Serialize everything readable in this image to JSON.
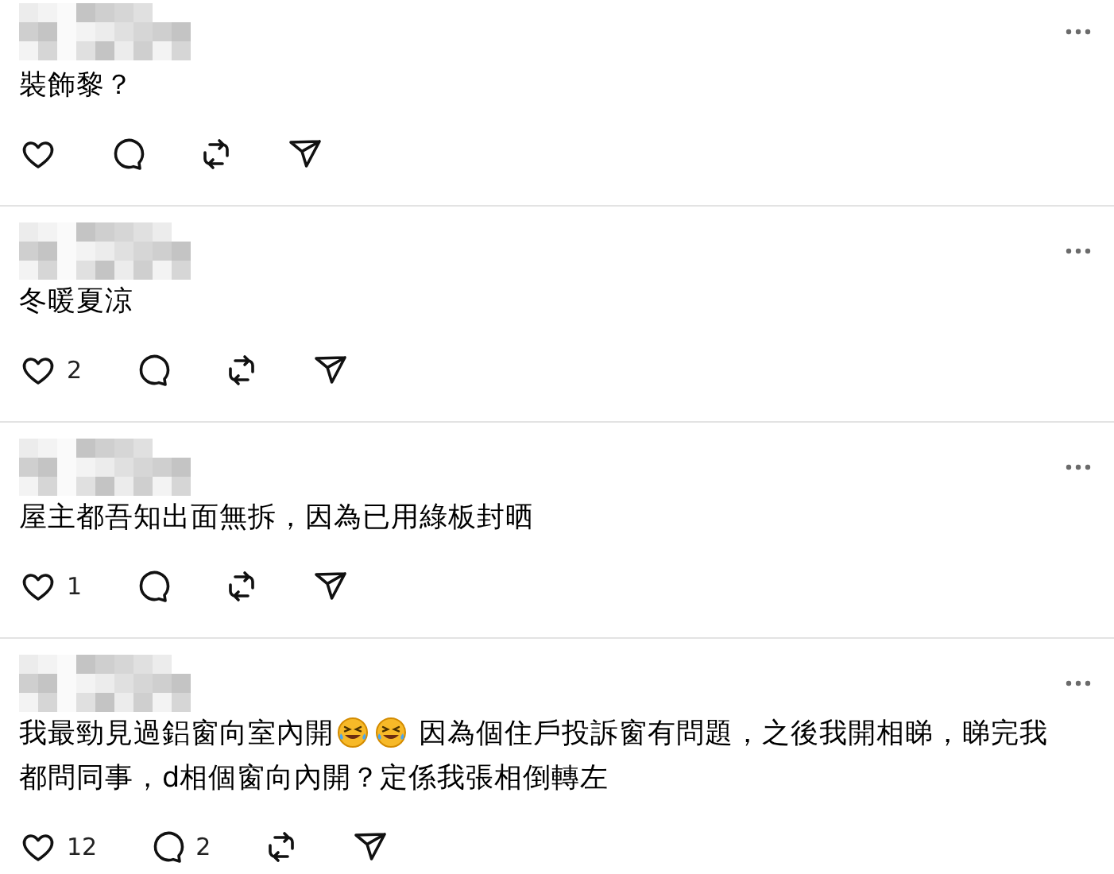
{
  "comments": [
    {
      "body": [
        {
          "kind": "text",
          "text": "裝飾黎？"
        }
      ]
    },
    {
      "body": [
        {
          "kind": "text",
          "text": "冬暖夏涼"
        }
      ],
      "likes": "2"
    },
    {
      "body": [
        {
          "kind": "text",
          "text": "屋主都吾知出面無拆，因為已用綠板封晒"
        }
      ],
      "likes": "1"
    },
    {
      "body": [
        {
          "kind": "text",
          "text": "我最勁見過鋁窗向室內開"
        },
        {
          "kind": "emoji"
        },
        {
          "kind": "emoji"
        },
        {
          "kind": "text",
          "text": " 因為個住戶投訴窗有問題，之後我開相睇，睇完我"
        },
        {
          "kind": "text",
          "text": "都問同事，d相個窗向內開？定係我張相倒轉左"
        }
      ],
      "likes": "12",
      "replies": "2"
    }
  ]
}
